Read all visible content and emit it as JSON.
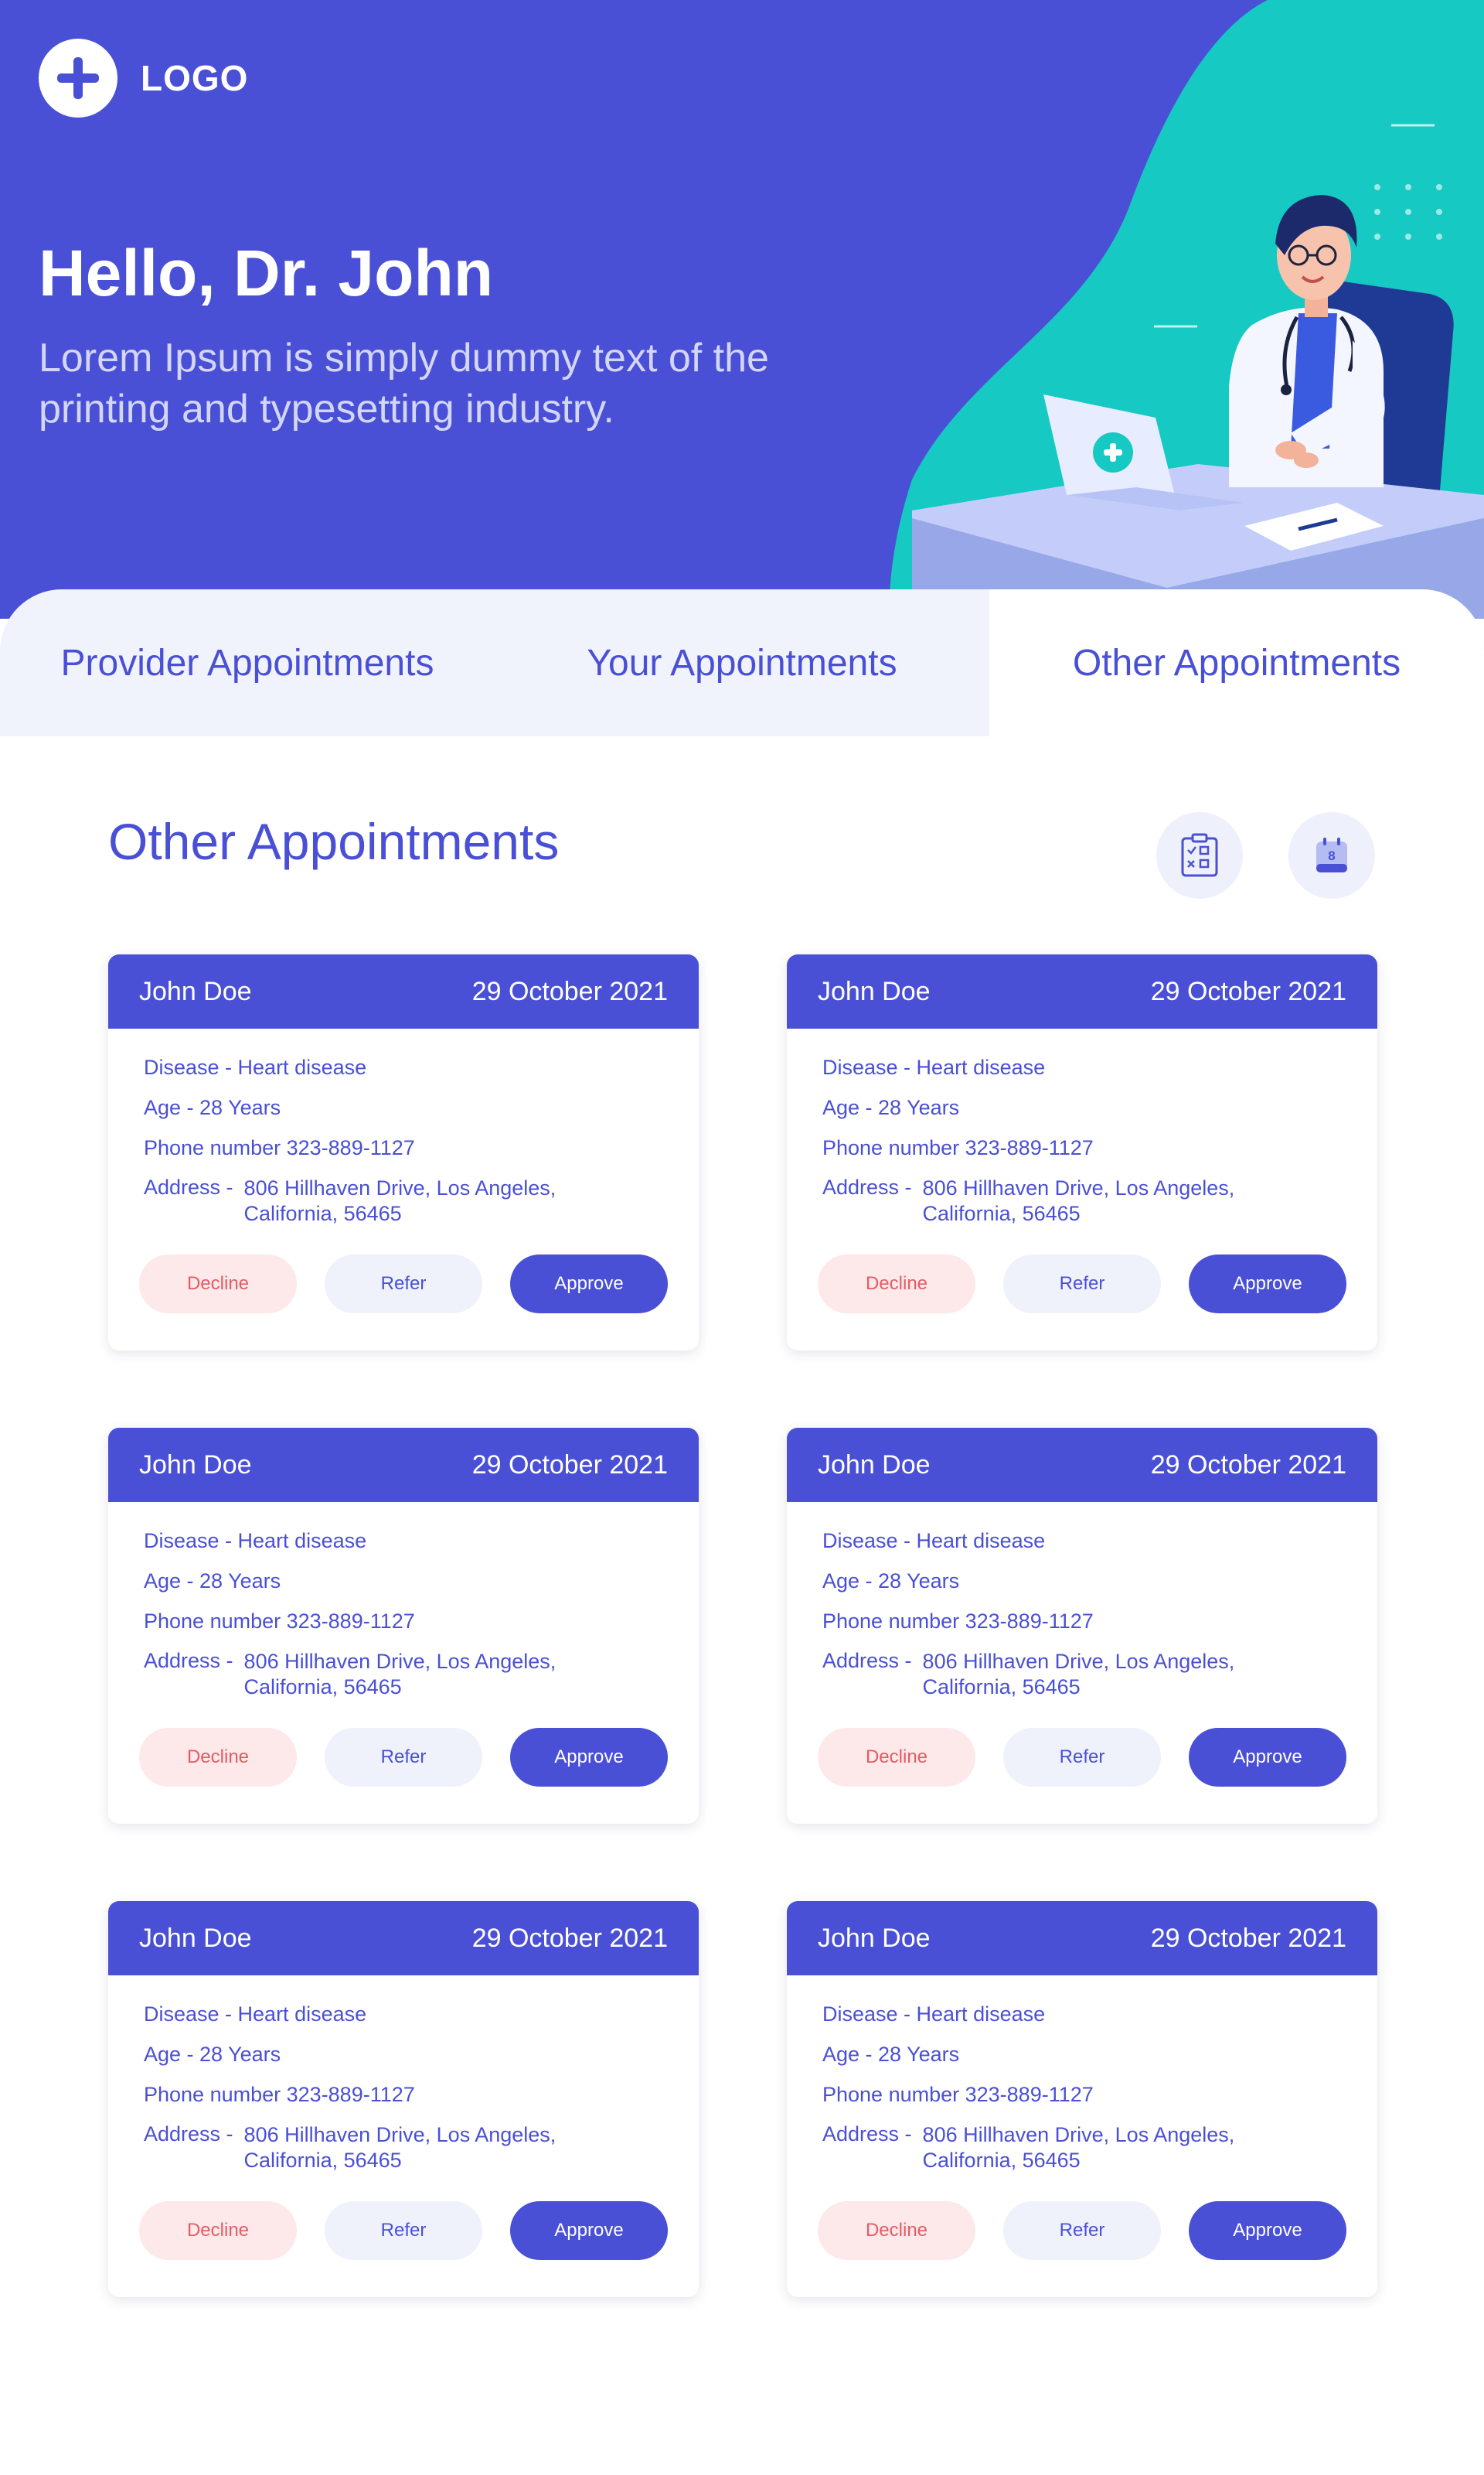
{
  "brand": {
    "logo_text": "LOGO"
  },
  "hero": {
    "greeting": "Hello, Dr. John",
    "subtitle": "Lorem Ipsum is simply dummy text of the printing and typesetting industry."
  },
  "tabs": [
    {
      "label": "Provider Appointments"
    },
    {
      "label": "Your Appointments"
    },
    {
      "label": "Other Appointments",
      "active": true
    }
  ],
  "section": {
    "title": "Other Appointments"
  },
  "toolbar_icons": [
    "clipboard-checklist-icon",
    "calendar-icon"
  ],
  "calendar_icon_day": "8",
  "colors": {
    "primary": "#4a50d5",
    "teal": "#16c9c3",
    "decline_bg": "#fde8ea",
    "decline_text": "#e65b63",
    "refer_bg": "#eff1fb"
  },
  "appointments": [
    {
      "name": "John Doe",
      "date": "29 October 2021",
      "disease": "Disease - Heart disease",
      "age": "Age - 28 Years",
      "phone": "Phone number  323-889-1127",
      "address_label": "Address -",
      "address": "806 Hillhaven Drive, Los Angeles, California, 56465",
      "decline": "Decline",
      "refer": "Refer",
      "approve": "Approve"
    },
    {
      "name": "John Doe",
      "date": "29 October 2021",
      "disease": "Disease - Heart disease",
      "age": "Age - 28 Years",
      "phone": "Phone number  323-889-1127",
      "address_label": "Address -",
      "address": "806 Hillhaven Drive, Los Angeles, California, 56465",
      "decline": "Decline",
      "refer": "Refer",
      "approve": "Approve"
    },
    {
      "name": "John Doe",
      "date": "29 October 2021",
      "disease": "Disease - Heart disease",
      "age": "Age - 28 Years",
      "phone": "Phone number  323-889-1127",
      "address_label": "Address -",
      "address": "806 Hillhaven Drive, Los Angeles, California, 56465",
      "decline": "Decline",
      "refer": "Refer",
      "approve": "Approve"
    },
    {
      "name": "John Doe",
      "date": "29 October 2021",
      "disease": "Disease - Heart disease",
      "age": "Age - 28 Years",
      "phone": "Phone number  323-889-1127",
      "address_label": "Address -",
      "address": "806 Hillhaven Drive, Los Angeles, California, 56465",
      "decline": "Decline",
      "refer": "Refer",
      "approve": "Approve"
    },
    {
      "name": "John Doe",
      "date": "29 October 2021",
      "disease": "Disease - Heart disease",
      "age": "Age - 28 Years",
      "phone": "Phone number  323-889-1127",
      "address_label": "Address -",
      "address": "806 Hillhaven Drive, Los Angeles, California, 56465",
      "decline": "Decline",
      "refer": "Refer",
      "approve": "Approve"
    },
    {
      "name": "John Doe",
      "date": "29 October 2021",
      "disease": "Disease - Heart disease",
      "age": "Age - 28 Years",
      "phone": "Phone number  323-889-1127",
      "address_label": "Address -",
      "address": "806 Hillhaven Drive, Los Angeles, California, 56465",
      "decline": "Decline",
      "refer": "Refer",
      "approve": "Approve"
    }
  ]
}
